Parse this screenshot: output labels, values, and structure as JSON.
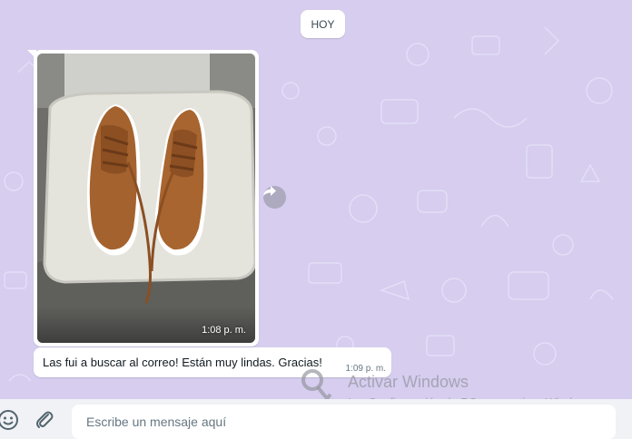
{
  "chat": {
    "day_divider": "HOY",
    "messages": [
      {
        "type": "image",
        "time": "1:08 p. m."
      },
      {
        "type": "text",
        "text": "Las fui a buscar al correo! Están muy lindas. Gracias!",
        "time": "1:09 p. m."
      }
    ]
  },
  "watermark": {
    "title": "Activar Windows",
    "subtitle": "Ir a Configuración de PC para activar Windows."
  },
  "composer": {
    "placeholder": "Escribe un mensaje aquí",
    "emoji_icon": "emoji-icon",
    "attach_icon": "paperclip-icon"
  },
  "colors": {
    "chat_background": "#d6cdef",
    "bubble": "#ffffff",
    "composer_bar": "#f0f2f5"
  }
}
